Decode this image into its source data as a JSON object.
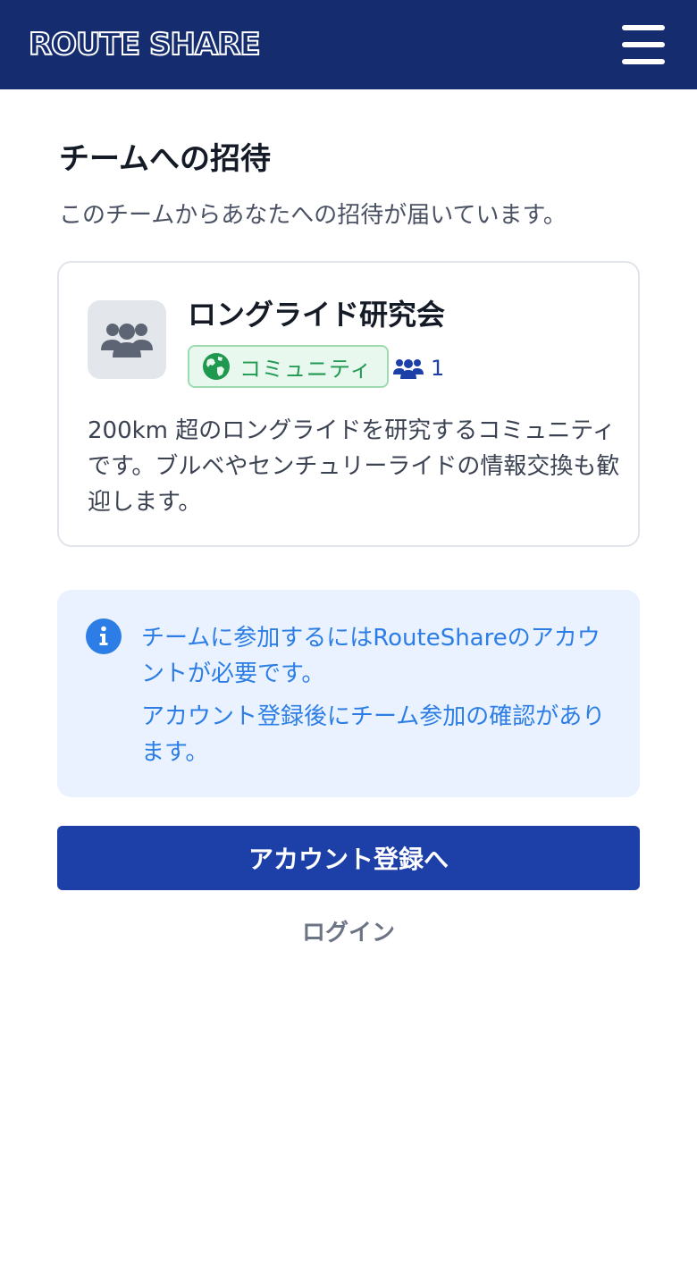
{
  "header": {
    "logo_text": "ROUTE SHARE",
    "menu_icon": "hamburger-menu-icon",
    "background_color": "#152c6f"
  },
  "page": {
    "title": "チームへの招待",
    "subtitle": "このチームからあなたへの招待が届いています。"
  },
  "team": {
    "avatar_icon": "group-icon",
    "name": "ロングライド研究会",
    "type_badge": {
      "icon": "globe-icon",
      "label": "コミュニティ",
      "color": "#1f9950"
    },
    "member_icon": "members-icon",
    "member_count": "1",
    "description": "200km 超のロングライドを研究するコミュニティです。ブルベやセンチュリーライドの情報交換も歓迎します。"
  },
  "info": {
    "icon": "info-icon",
    "line1": "チームに参加するにはRouteShareのアカウントが必要です。",
    "line2": "アカウント登録後にチーム参加の確認があります。",
    "color": "#2c7ee6"
  },
  "actions": {
    "register_label": "アカウント登録へ",
    "login_label": "ログイン",
    "primary_color": "#1d3fa8"
  }
}
